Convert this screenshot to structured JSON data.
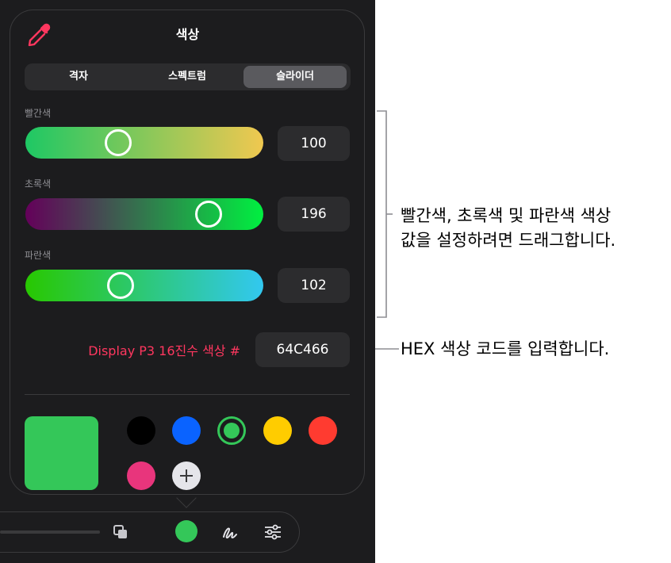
{
  "panel": {
    "title": "색상",
    "tabs": [
      {
        "label": "격자",
        "active": false
      },
      {
        "label": "스펙트럼",
        "active": false
      },
      {
        "label": "슬라이더",
        "active": true
      }
    ],
    "sliders": [
      {
        "label": "빨간색",
        "value": "100",
        "level": 0.39,
        "gradient": [
          "#1ec864",
          "#f0c850"
        ]
      },
      {
        "label": "초록색",
        "value": "196",
        "level": 0.77,
        "gradient": [
          "#64005a",
          "#00f040"
        ]
      },
      {
        "label": "파란색",
        "value": "102",
        "level": 0.4,
        "gradient": [
          "#28c800",
          "#32c8f0"
        ]
      }
    ],
    "hex": {
      "label": "Display P3 16진수 색상 #",
      "value": "64C466"
    },
    "current_color": "#34c759",
    "swatches": [
      {
        "name": "black",
        "color": "#000000",
        "selected": false
      },
      {
        "name": "blue",
        "color": "#0a63ff",
        "selected": false
      },
      {
        "name": "green",
        "color": "#34c759",
        "selected": true
      },
      {
        "name": "yellow",
        "color": "#ffcc00",
        "selected": false
      },
      {
        "name": "red",
        "color": "#ff3b30",
        "selected": false
      },
      {
        "name": "pink",
        "color": "#e8357c",
        "selected": false
      }
    ]
  },
  "annotations": {
    "sliders_callout": [
      "빨간색, 초록색 및 파란색 색상",
      "값을 설정하려면 드래그합니다."
    ],
    "hex_callout": "HEX 색상 코드를 입력합니다."
  },
  "colors": {
    "accent_label": "#ff375f",
    "eyedropper": "#ff375f"
  }
}
